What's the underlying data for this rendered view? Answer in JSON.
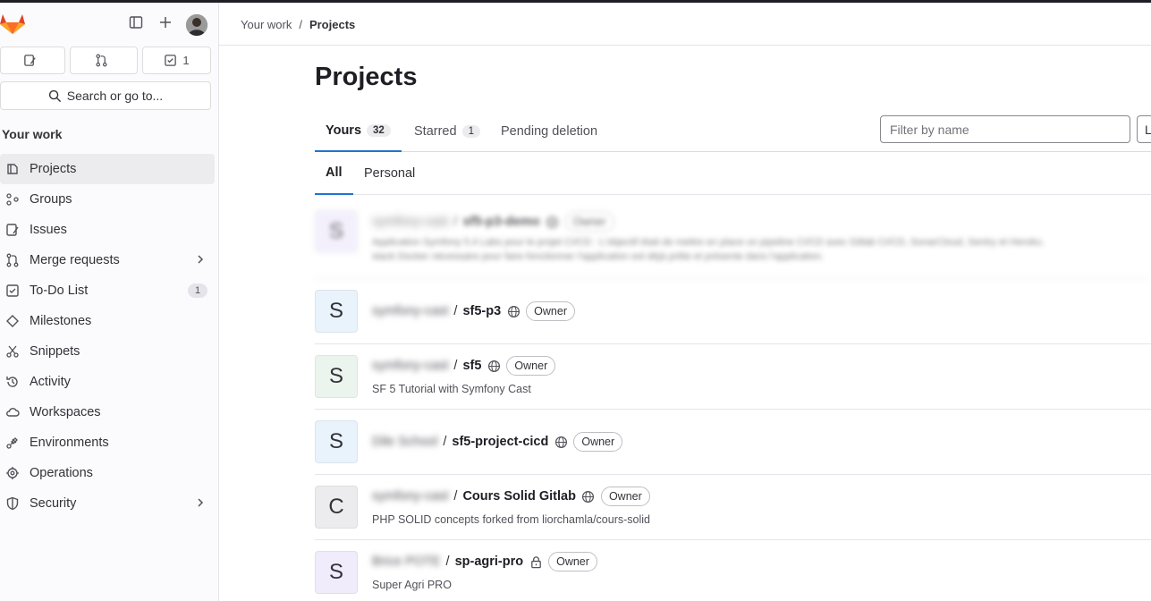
{
  "sidebar": {
    "counters": {
      "issues": "",
      "merge_requests": "",
      "todos": "1"
    },
    "search_label": "Search or go to...",
    "section_heading": "Your work",
    "items": [
      {
        "label": "Projects",
        "icon": "project-icon"
      },
      {
        "label": "Groups",
        "icon": "group-icon"
      },
      {
        "label": "Issues",
        "icon": "issues-icon"
      },
      {
        "label": "Merge requests",
        "icon": "merge-request-icon"
      },
      {
        "label": "To-Do List",
        "icon": "todo-icon",
        "count": "1"
      },
      {
        "label": "Milestones",
        "icon": "milestone-icon"
      },
      {
        "label": "Snippets",
        "icon": "snippet-icon"
      },
      {
        "label": "Activity",
        "icon": "history-icon"
      },
      {
        "label": "Workspaces",
        "icon": "cloud-icon"
      },
      {
        "label": "Environments",
        "icon": "environment-icon"
      },
      {
        "label": "Operations",
        "icon": "deployment-icon"
      },
      {
        "label": "Security",
        "icon": "shield-icon"
      }
    ]
  },
  "breadcrumb": {
    "parent": "Your work",
    "separator": "/",
    "current": "Projects"
  },
  "page_title": "Projects",
  "tabs": [
    {
      "label": "Yours",
      "count": "32"
    },
    {
      "label": "Starred",
      "count": "1"
    },
    {
      "label": "Pending deletion"
    }
  ],
  "filter": {
    "placeholder": "Filter by name",
    "sort_label": "L"
  },
  "subtabs": [
    {
      "label": "All"
    },
    {
      "label": "Personal"
    }
  ],
  "projects": [
    {
      "letter": "S",
      "namespace": "symfony-cast",
      "name": "sf5-p3-demo",
      "role": "Owner",
      "visibility": "public",
      "description": "Application Symfony 5.4 Labs pour le projet CI/CD : L'objectif était de mettre en place un pipeline CI/CD avec Gitlab CI/CD, SonarCloud, Sentry et Heroku.",
      "description2": "stack Docker nécessaire pour faire fonctionner l'application est déjà prête et présente dans l'application."
    },
    {
      "letter": "S",
      "namespace": "symfony-cast",
      "name": "sf5-p3",
      "role": "Owner",
      "visibility": "public",
      "description": ""
    },
    {
      "letter": "S",
      "namespace": "symfony-cast",
      "name": "sf5",
      "role": "Owner",
      "visibility": "public",
      "description": "SF 5 Tutorial with Symfony Cast"
    },
    {
      "letter": "S",
      "namespace": "Dile School",
      "name": "sf5-project-cicd",
      "role": "Owner",
      "visibility": "public",
      "description": ""
    },
    {
      "letter": "C",
      "namespace": "symfony-cast",
      "name": "Cours Solid Gitlab",
      "role": "Owner",
      "visibility": "public",
      "description": "PHP SOLID concepts forked from liorchamla/cours-solid"
    },
    {
      "letter": "S",
      "namespace": "Brice POTE",
      "name": "sp-agri-pro",
      "role": "Owner",
      "visibility": "private",
      "description": "Super Agri PRO"
    }
  ],
  "colors": {
    "active_tab": "#1f75cb",
    "avatar_bg": [
      "#f0ecfb",
      "#e9f3fc",
      "#ecf4ee",
      "#e9f3fc",
      "#ececef",
      "#f0ecfb"
    ]
  }
}
